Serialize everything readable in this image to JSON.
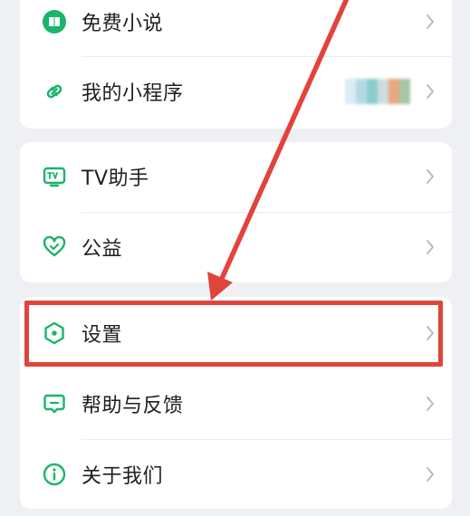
{
  "menu": {
    "group1": [
      {
        "id": "free-novel",
        "label": "免费小说",
        "icon": "book-icon"
      },
      {
        "id": "mini-programs",
        "label": "我的小程序",
        "icon": "link-icon",
        "has_thumbnail": true
      }
    ],
    "group2": [
      {
        "id": "tv-assistant",
        "label": "TV助手",
        "icon": "tv-icon"
      },
      {
        "id": "charity",
        "label": "公益",
        "icon": "heart-icon"
      }
    ],
    "group3": [
      {
        "id": "settings",
        "label": "设置",
        "icon": "hexagon-settings-icon",
        "highlighted": true
      },
      {
        "id": "help-feedback",
        "label": "帮助与反馈",
        "icon": "message-icon"
      },
      {
        "id": "about-us",
        "label": "关于我们",
        "icon": "info-icon"
      }
    ]
  },
  "colors": {
    "accent_green": "#19b56b",
    "highlight_red": "#e0443a",
    "background": "#eef0f3",
    "card": "#ffffff",
    "text": "#1f1f1f",
    "chevron": "#b6b6b6"
  }
}
